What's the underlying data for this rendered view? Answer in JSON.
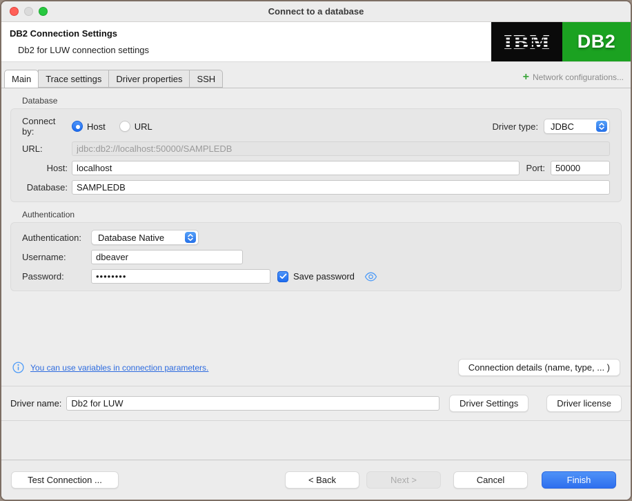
{
  "window": {
    "title": "Connect to a database"
  },
  "header": {
    "title": "DB2 Connection Settings",
    "subtitle": "Db2 for LUW connection settings",
    "ibm_logo": "IBM",
    "db2_logo": "DB2"
  },
  "tabs": [
    {
      "label": "Main",
      "active": true
    },
    {
      "label": "Trace settings",
      "active": false
    },
    {
      "label": "Driver properties",
      "active": false
    },
    {
      "label": "SSH",
      "active": false
    }
  ],
  "network": {
    "plus": "+",
    "label": "Network configurations..."
  },
  "database": {
    "group_label": "Database",
    "connect_by_label": "Connect by:",
    "host_radio_label": "Host",
    "url_radio_label": "URL",
    "driver_type_label": "Driver type:",
    "driver_type_value": "JDBC",
    "url_label": "URL:",
    "url_value": "jdbc:db2://localhost:50000/SAMPLEDB",
    "host_label": "Host:",
    "host_value": "localhost",
    "port_label": "Port:",
    "port_value": "50000",
    "database_label": "Database:",
    "database_value": "SAMPLEDB"
  },
  "authentication": {
    "group_label": "Authentication",
    "auth_label": "Authentication:",
    "auth_value": "Database Native",
    "username_label": "Username:",
    "username_value": "dbeaver",
    "password_label": "Password:",
    "password_value": "••••••••",
    "save_password_label": "Save password"
  },
  "links": {
    "variables_link": "You can use variables in connection parameters.",
    "connection_details_button": "Connection details (name, type, ... )"
  },
  "driver": {
    "name_label": "Driver name:",
    "name_value": "Db2 for LUW",
    "settings_button": "Driver Settings",
    "license_button": "Driver license"
  },
  "footer": {
    "test_connection_button": "Test Connection ...",
    "back_button": "< Back",
    "next_button": "Next >",
    "cancel_button": "Cancel",
    "finish_button": "Finish"
  },
  "colors": {
    "accent_blue": "#2E6FEE",
    "link_blue": "#2D6BDF",
    "plus_green": "#3DA63D",
    "db2_green": "#1BA221",
    "traffic_red": "#FF5F57",
    "traffic_gray": "#DBDBDB",
    "traffic_green": "#28C840"
  }
}
